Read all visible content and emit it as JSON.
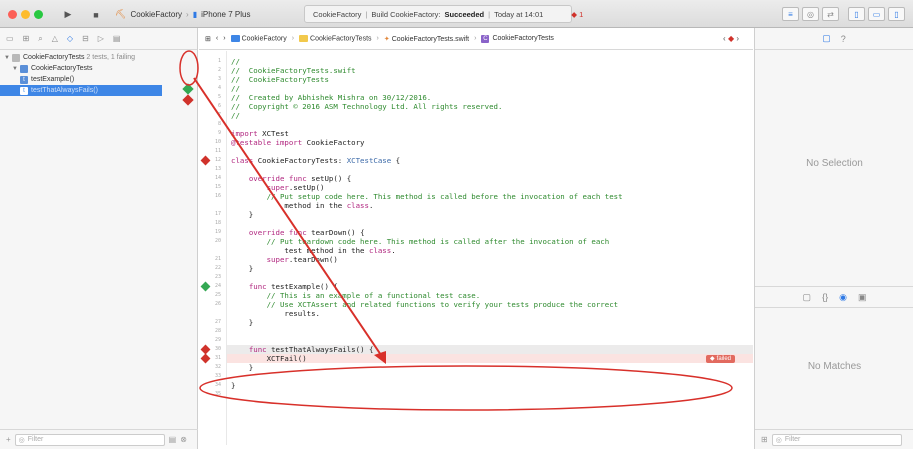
{
  "toolbar": {
    "scheme": "CookieFactory",
    "device": "iPhone 7 Plus",
    "status_project": "CookieFactory",
    "status_build": "Build CookieFactory:",
    "status_result": "Succeeded",
    "status_time": "Today at 14:01",
    "issue_count": "1"
  },
  "navigator": {
    "summary_name": "CookieFactoryTests",
    "summary_detail": "2 tests, 1 failing",
    "group": "CookieFactoryTests",
    "tests": [
      {
        "name": "testExample()",
        "status": "passed"
      },
      {
        "name": "testThatAlwaysFails()",
        "status": "failed"
      }
    ],
    "filter_placeholder": "Filter"
  },
  "jumpbar": {
    "crumbs": [
      "CookieFactory",
      "CookieFactoryTests",
      "CookieFactoryTests.swift",
      "CookieFactoryTests"
    ]
  },
  "code": {
    "lines": [
      {
        "n": "1",
        "t": "//"
      },
      {
        "n": "2",
        "t": "//  CookieFactoryTests.swift"
      },
      {
        "n": "3",
        "t": "//  CookieFactoryTests"
      },
      {
        "n": "4",
        "t": "//"
      },
      {
        "n": "5",
        "t": "//  Created by Abhishek Mishra on 30/12/2016."
      },
      {
        "n": "6",
        "t": "//  Copyright © 2016 ASM Technology Ltd. All rights reserved."
      },
      {
        "n": "7",
        "t": "//"
      },
      {
        "n": "8",
        "t": ""
      },
      {
        "n": "9",
        "t": "import XCTest"
      },
      {
        "n": "10",
        "t": "@testable import CookieFactory"
      },
      {
        "n": "11",
        "t": ""
      },
      {
        "n": "12",
        "t": "class CookieFactoryTests: XCTestCase {"
      },
      {
        "n": "13",
        "t": ""
      },
      {
        "n": "14",
        "t": "    override func setUp() {"
      },
      {
        "n": "15",
        "t": "        super.setUp()"
      },
      {
        "n": "16",
        "t": "        // Put setup code here. This method is called before the invocation of each test"
      },
      {
        "n": "",
        "t": "            method in the class."
      },
      {
        "n": "17",
        "t": "    }"
      },
      {
        "n": "18",
        "t": ""
      },
      {
        "n": "19",
        "t": "    override func tearDown() {"
      },
      {
        "n": "20",
        "t": "        // Put teardown code here. This method is called after the invocation of each"
      },
      {
        "n": "",
        "t": "            test method in the class."
      },
      {
        "n": "21",
        "t": "        super.tearDown()"
      },
      {
        "n": "22",
        "t": "    }"
      },
      {
        "n": "23",
        "t": ""
      },
      {
        "n": "24",
        "t": "    func testExample() {"
      },
      {
        "n": "25",
        "t": "        // This is an example of a functional test case."
      },
      {
        "n": "26",
        "t": "        // Use XCTAssert and related functions to verify your tests produce the correct"
      },
      {
        "n": "",
        "t": "            results."
      },
      {
        "n": "27",
        "t": "    }"
      },
      {
        "n": "28",
        "t": ""
      },
      {
        "n": "29",
        "t": ""
      },
      {
        "n": "30",
        "t": "    func testThatAlwaysFails() {"
      },
      {
        "n": "31",
        "t": "        XCTFail()"
      },
      {
        "n": "32",
        "t": "    }"
      },
      {
        "n": "33",
        "t": ""
      },
      {
        "n": "34",
        "t": "}"
      },
      {
        "n": "35",
        "t": ""
      }
    ],
    "failed_label": "failed"
  },
  "inspector": {
    "no_selection": "No Selection",
    "no_matches": "No Matches",
    "filter_placeholder": "Filter"
  }
}
